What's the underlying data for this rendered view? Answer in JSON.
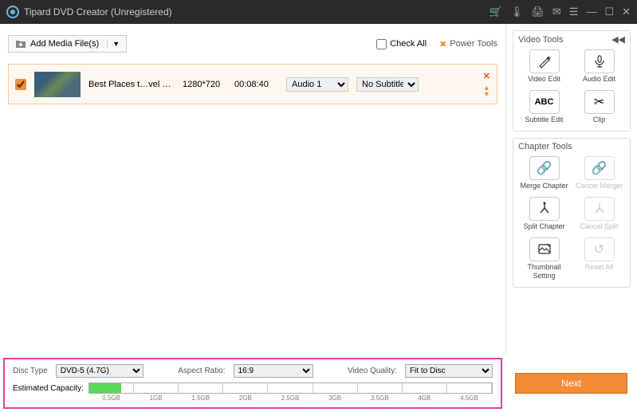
{
  "title": "Tipard DVD Creator (Unregistered)",
  "toolbar": {
    "add_media_label": "Add Media File(s)",
    "check_all_label": "Check All",
    "power_tools_label": "Power Tools"
  },
  "media_items": [
    {
      "checked": true,
      "filename": "Best Places t…vel Video.avi",
      "resolution": "1280*720",
      "duration": "00:08:40",
      "audio_selected": "Audio 1",
      "subtitle_selected": "No Subtitle"
    }
  ],
  "video_tools": {
    "header": "Video Tools",
    "items": [
      {
        "label": "Video Edit",
        "icon": "wand"
      },
      {
        "label": "Audio Edit",
        "icon": "mic"
      },
      {
        "label": "Subtitle Edit",
        "icon": "abc"
      },
      {
        "label": "Clip",
        "icon": "scissors"
      }
    ]
  },
  "chapter_tools": {
    "header": "Chapter Tools",
    "items": [
      {
        "label": "Merge Chapter",
        "icon": "link",
        "enabled": true
      },
      {
        "label": "Cancel Merger",
        "icon": "link-off",
        "enabled": false
      },
      {
        "label": "Split Chapter",
        "icon": "split",
        "enabled": true
      },
      {
        "label": "Cancel Split",
        "icon": "split-off",
        "enabled": false
      },
      {
        "label": "Thumbnail Setting",
        "icon": "thumb",
        "enabled": true
      },
      {
        "label": "Reset All",
        "icon": "reset",
        "enabled": false
      }
    ]
  },
  "settings": {
    "disc_type_label": "Disc Type",
    "disc_type_value": "DVD-5 (4.7G)",
    "aspect_ratio_label": "Aspect Ratio:",
    "aspect_ratio_value": "16:9",
    "video_quality_label": "Video Quality:",
    "video_quality_value": "Fit to Disc",
    "capacity_label": "Estimated Capacity:",
    "ticks": [
      "0.5GB",
      "1GB",
      "1.5GB",
      "2GB",
      "2.5GB",
      "3GB",
      "3.5GB",
      "4GB",
      "4.5GB"
    ],
    "fill_percent": 8
  },
  "next_label": "Next"
}
